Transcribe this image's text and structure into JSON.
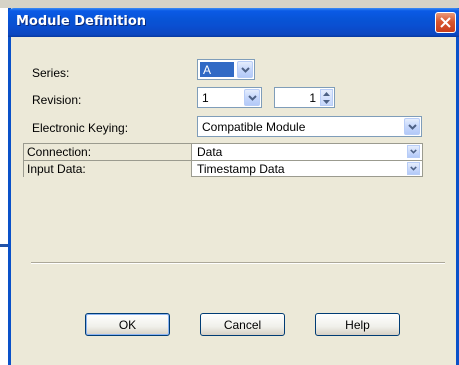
{
  "dialog": {
    "title": "Module Definition"
  },
  "fields": {
    "series": {
      "label": "Series:",
      "value": "A"
    },
    "revision": {
      "label": "Revision:",
      "major": "1",
      "minor": "1"
    },
    "electronic_keying": {
      "label": "Electronic Keying:",
      "value": "Compatible Module"
    }
  },
  "grid": {
    "rows": [
      {
        "label": "Connection:",
        "value": "Data"
      },
      {
        "label": "Input Data:",
        "value": "Timestamp Data"
      }
    ]
  },
  "buttons": {
    "ok": "OK",
    "cancel": "Cancel",
    "help": "Help"
  },
  "icons": {
    "close": "close-icon",
    "dropdown": "chevron-down-icon",
    "spin": "spin-arrows-icon"
  },
  "colors": {
    "titlebar": "#0a5ae6",
    "close": "#d8562f",
    "selection": "#316ac5",
    "dialog_bg": "#ece9d8"
  }
}
